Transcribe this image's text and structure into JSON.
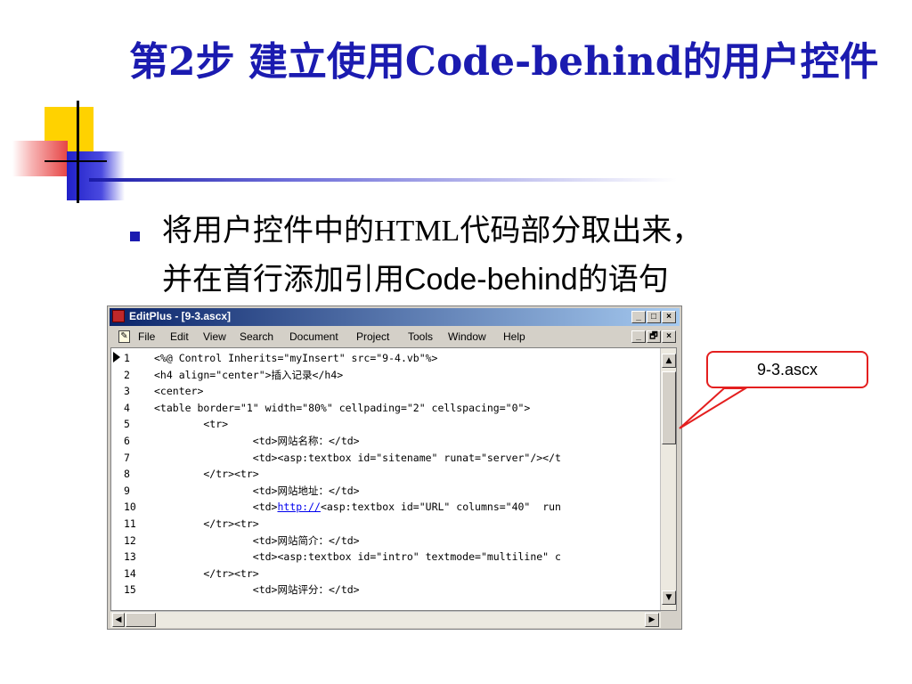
{
  "slide": {
    "title": "第2步 建立使用Code-behind的用户控件",
    "bullet_line1_a": "将用户控件中的",
    "bullet_line1_b": "HTML",
    "bullet_line1_c": "代码部分取出来，",
    "bullet_line2_a": "并在首行添加引用",
    "bullet_line2_b": "Code-behind",
    "bullet_line2_c": "的语句",
    "callout": "9-3.ascx"
  },
  "editor_window": {
    "title": "EditPlus - [9-3.ascx]",
    "title_buttons": [
      "_",
      "□",
      "×"
    ],
    "doc_buttons": [
      "_",
      "🗗",
      "×"
    ],
    "menu": [
      "File",
      "Edit",
      "View",
      "Search",
      "Document",
      "Project",
      "Tools",
      "Window",
      "Help"
    ],
    "lines": [
      {
        "n": "1",
        "code": "<%@ Control Inherits=\"myInsert\" src=\"9-4.vb\"%>"
      },
      {
        "n": "2",
        "code": "<h4 align=\"center\">插入记录</h4>"
      },
      {
        "n": "3",
        "code": "<center>"
      },
      {
        "n": "4",
        "code": "<table border=\"1\" width=\"80%\" cellpading=\"2\" cellspacing=\"0\">"
      },
      {
        "n": "5",
        "code": "        <tr>"
      },
      {
        "n": "6",
        "code": "                <td>网站名称：</td>"
      },
      {
        "n": "7",
        "code": "                <td><asp:textbox id=\"sitename\" runat=\"server\"/></t"
      },
      {
        "n": "8",
        "code": "        </tr><tr>"
      },
      {
        "n": "9",
        "code": "                <td>网站地址：</td>"
      },
      {
        "n": "10",
        "pre": "                <td>",
        "link": "http://",
        "post": "<asp:textbox id=\"URL\" columns=\"40\"  run"
      },
      {
        "n": "11",
        "code": "        </tr><tr>"
      },
      {
        "n": "12",
        "code": "                <td>网站简介：</td>"
      },
      {
        "n": "13",
        "code": "                <td><asp:textbox id=\"intro\" textmode=\"multiline\" c"
      },
      {
        "n": "14",
        "code": "        </tr><tr>"
      },
      {
        "n": "15",
        "code": "                <td>网站评分：</td>"
      }
    ]
  }
}
